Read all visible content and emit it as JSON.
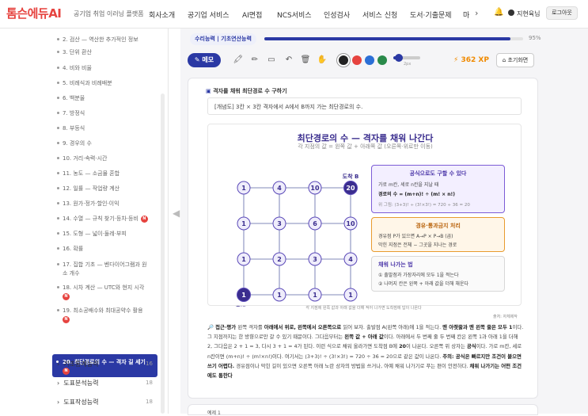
{
  "header": {
    "logo": "톰슨에듀AI",
    "tagline": "공기업 취업 이러닝 플랫폼",
    "nav": [
      "회사소개",
      "공기업 서비스",
      "AI면접",
      "NCS서비스",
      "인성검사",
      "서비스 신청",
      "도서·기출문제",
      "마"
    ],
    "user_name": "지현육님",
    "logout": "로그아웃"
  },
  "sidebar": {
    "items": [
      {
        "label": "2. 검산 — 역산한 추가적인 정보"
      },
      {
        "label": "3. 단위 환산"
      },
      {
        "label": "4. 비와 비율"
      },
      {
        "label": "5. 비례식과 비례배분"
      },
      {
        "label": "6. 백분율"
      },
      {
        "label": "7. 방정식"
      },
      {
        "label": "8. 부등식"
      },
      {
        "label": "9. 경우의 수"
      },
      {
        "label": "10. 거리·속력·시간"
      },
      {
        "label": "11. 농도 — 소금물 혼합"
      },
      {
        "label": "12. 일률 — 작업량 계산"
      },
      {
        "label": "13. 원가·정가·할인·이익"
      },
      {
        "label": "14. 수열 — 규칙 찾기·등차·등비"
      },
      {
        "label": "15. 도형 — 넓이·둘레·부피"
      },
      {
        "label": "16. 확률"
      },
      {
        "label": "17. 집합 기초 — 벤다이어그램과 원"
      },
      {
        "label": "소 개수"
      },
      {
        "label": "18. 시차 계산 — UTC와 현지 시각"
      },
      {
        "label": "19. 최소공배수와 최대공약수 활용"
      }
    ],
    "active": "20. 최단경로의 수 — 격자 길 세기",
    "new_badge": "N",
    "groups": [
      {
        "label": "기초통계능력",
        "count": "16"
      },
      {
        "label": "도표분석능력",
        "count": "18"
      },
      {
        "label": "도표작성능력",
        "count": "18"
      }
    ]
  },
  "progress": {
    "label": "수리능력 | 기초연산능력",
    "percent_text": "95%",
    "percent": 95
  },
  "toolbar": {
    "memo": "메모",
    "icons": [
      "highlighter-icon",
      "pen-icon",
      "eraser-icon",
      "undo-icon",
      "trash-icon",
      "hand-icon"
    ],
    "colors": [
      "#222222",
      "#e6433f",
      "#2b6fd6",
      "#2a8a4a"
    ],
    "size_label": "2px",
    "xp": "362 XP",
    "reset": "초기화면"
  },
  "content": {
    "card_title": "격자를 채워 최단경로 수 구하기",
    "prompt": "[개념도] 3칸 × 3칸 격자에서 A에서 B까지 가는 최단경로의 수.",
    "figure": {
      "title": "최단경로의 수 — 격자를 채워 나간다",
      "subtitle": "각 지점의 값 = 왼쪽 값 + 아래쪽 값 (오른쪽·위로만 이동)",
      "grid": [
        [
          "1",
          "4",
          "10",
          "20"
        ],
        [
          "1",
          "3",
          "6",
          "10"
        ],
        [
          "1",
          "2",
          "3",
          "4"
        ],
        [
          "1",
          "1",
          "1",
          "1"
        ]
      ],
      "label_a": "출발 A",
      "label_b": "도착 B",
      "box1": {
        "title": "공식으로도 구할 수 있다",
        "line1": "가로 m칸, 세로 n칸을 지날 때",
        "line2": "경로의 수 = (m+n)! ÷ (m! × n!)",
        "line3": "위 그림: (3+3)! ÷ (3!×3!) = 720 ÷ 36 = 20"
      },
      "box2": {
        "title": "경유·통과금지 처리",
        "line1": "경유점 P가 있으면 A→P × P→B (곱)",
        "line2": "막힌 지점은 전체 − 그곳을 지나는 경로"
      },
      "box3": {
        "title": "채워 나가는 법",
        "line1": "① 출발점과 가장자리에 모두 1을 적는다",
        "line2": "② 나머지 칸은 왼쪽 + 아래 값을 더해 채운다"
      }
    },
    "caption": "각 지점에 왼쪽 값과 아래 값을 더해 적어 나가면 도착점에 답이 나온다",
    "source": "출처: 자체제작",
    "explanation": [
      {
        "b": true,
        "t": "🔎 접근·평가 "
      },
      {
        "b": false,
        "t": "왼쪽 격자를 "
      },
      {
        "b": true,
        "t": "아래에서 위로, 왼쪽에서 오른쪽으로 "
      },
      {
        "b": false,
        "t": "읽어 보자. 출발점 A(왼쪽 아래)에 1을 적는다. "
      },
      {
        "b": true,
        "t": "맨 아랫줄과 맨 왼쪽 줄은 모두 1"
      },
      {
        "b": false,
        "t": "이다. 그 지점까지는 한 방향으로만 갈 수 있기 때문이다. 그다음부터는 "
      },
      {
        "b": true,
        "t": "왼쪽 값 + 아래 값"
      },
      {
        "b": false,
        "t": "이다. 아래에서 두 번째 줄 두 번째 칸은 왼쪽 1과 아래 1을 더해 2, 그다음은 2 + 1 = 3, 다시 3 + 1 = 4가 된다. 이런 식으로 채워 올라가면 도착점 B에 "
      },
      {
        "b": true,
        "t": "20"
      },
      {
        "b": false,
        "t": "이 나온다. 오른쪽 위 상자는 "
      },
      {
        "b": true,
        "t": "공식"
      },
      {
        "b": false,
        "t": "이다. 가로 m칸, 세로 n칸이면 (m+n)! ÷ (m!×n!)이다. 여기서는 (3+3)! ÷ (3!×3!) = 720 ÷ 36 = 20으로 같은 값이 나온다. "
      },
      {
        "b": true,
        "t": "주의: 공식은 빠르지만 조건이 붙으면 쓰기 어렵다. "
      },
      {
        "b": false,
        "t": "경유점이나 막힌 길이 있으면 오른쪽 아래 노란 상자의 방법을 쓰거나, 아예 채워 나가기로 푸는 편이 안전하다. "
      },
      {
        "b": true,
        "t": "채워 나가기는 어떤 조건에도 통한다"
      }
    ],
    "next_label": "예제 1"
  }
}
